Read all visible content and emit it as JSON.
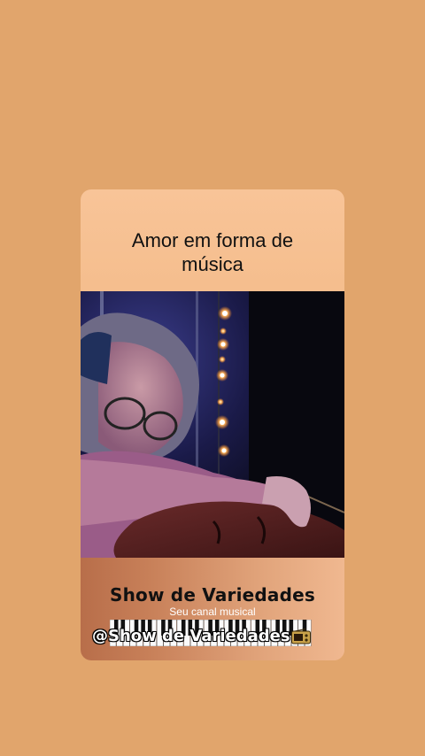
{
  "card": {
    "title_line1": "Amor em forma de",
    "title_line2": "música"
  },
  "video": {
    "description_icon": "violinist-video"
  },
  "footer": {
    "brand": "Show de Variedades",
    "tagline": "Seu canal musical",
    "handle": "@Show de Variedades",
    "handle_icon": "radio-icon"
  },
  "colors": {
    "background": "#E1A56C",
    "card": "#F8C498",
    "footer_dark": "#B86E4A",
    "footer_light": "#F0B890"
  }
}
